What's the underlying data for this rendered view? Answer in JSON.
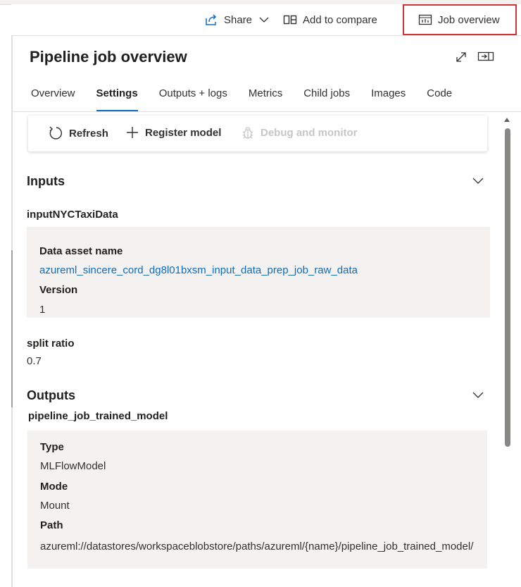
{
  "toolbar": {
    "share_label": "Share",
    "compare_label": "Add to compare",
    "overview_label": "Job overview"
  },
  "panel": {
    "title": "Pipeline job overview"
  },
  "tabs": [
    {
      "label": "Overview"
    },
    {
      "label": "Settings"
    },
    {
      "label": "Outputs + logs"
    },
    {
      "label": "Metrics"
    },
    {
      "label": "Child jobs"
    },
    {
      "label": "Images"
    },
    {
      "label": "Code"
    }
  ],
  "active_tab": "Settings",
  "actions": {
    "refresh_label": "Refresh",
    "register_label": "Register model",
    "debug_label": "Debug and monitor"
  },
  "inputs": {
    "heading": "Inputs",
    "item_name": "inputNYCTaxiData",
    "data_asset_label": "Data asset name",
    "data_asset_value": "azureml_sincere_cord_dg8l01bxsm_input_data_prep_job_raw_data",
    "version_label": "Version",
    "version_value": "1",
    "split_label": "split ratio",
    "split_value": "0.7"
  },
  "outputs": {
    "heading": "Outputs",
    "item_name": "pipeline_job_trained_model",
    "type_label": "Type",
    "type_value": "MLFlowModel",
    "mode_label": "Mode",
    "mode_value": "Mount",
    "path_label": "Path",
    "path_value": "azureml://datastores/workspaceblobstore/paths/azureml/{name}/pipeline_job_trained_model/"
  },
  "colors": {
    "accent": "#0f6cbd",
    "highlight_border": "#d13438",
    "card_background": "#f3f2f1"
  },
  "icons": [
    "share-icon",
    "chevron-down-icon",
    "compare-icon",
    "dashboard-icon",
    "expand-icon",
    "dock-panel-icon",
    "refresh-icon",
    "plus-icon",
    "bug-icon",
    "scroll-up-icon"
  ]
}
